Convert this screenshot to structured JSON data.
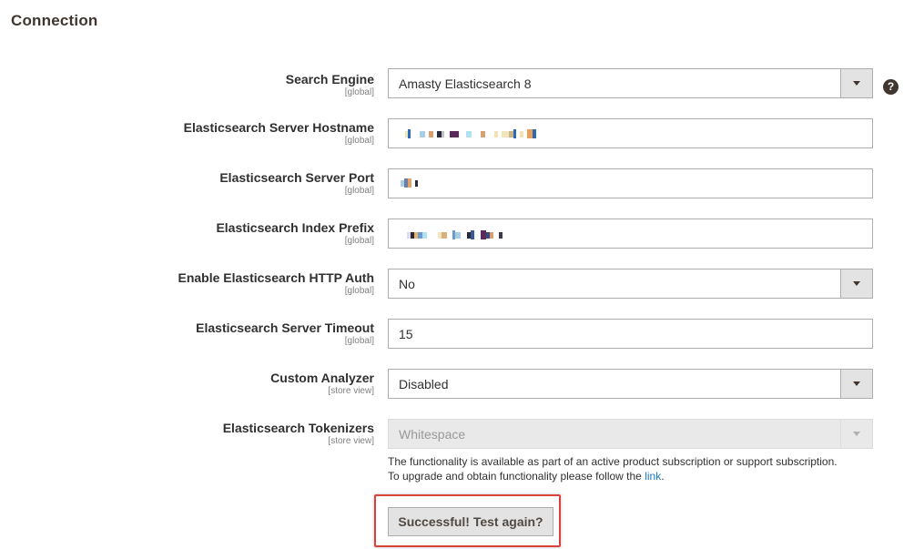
{
  "section": {
    "title": "Connection"
  },
  "fields": [
    {
      "label": "Search Engine",
      "scope": "[global]",
      "type": "select",
      "value": "Amasty Elasticsearch 8"
    },
    {
      "label": "Elasticsearch Server Hostname",
      "scope": "[global]",
      "type": "text",
      "value": ""
    },
    {
      "label": "Elasticsearch Server Port",
      "scope": "[global]",
      "type": "text",
      "value": ""
    },
    {
      "label": "Elasticsearch Index Prefix",
      "scope": "[global]",
      "type": "text",
      "value": ""
    },
    {
      "label": "Enable Elasticsearch HTTP Auth",
      "scope": "[global]",
      "type": "select",
      "value": "No"
    },
    {
      "label": "Elasticsearch Server Timeout",
      "scope": "[global]",
      "type": "text",
      "value": "15"
    },
    {
      "label": "Custom Analyzer",
      "scope": "[store view]",
      "type": "select",
      "value": "Disabled"
    },
    {
      "label": "Elasticsearch Tokenizers",
      "scope": "[store view]",
      "type": "select",
      "value": "Whitespace",
      "disabled": true
    }
  ],
  "note": {
    "line1": "The functionality is available as part of an active product subscription or support subscription.",
    "line2_prefix": "To upgrade and obtain functionality please follow the ",
    "link_text": "link",
    "line2_suffix": "."
  },
  "test_button": {
    "label": "Successful! Test again?"
  },
  "help_icon": {
    "glyph": "?",
    "icon": "question-circle-icon"
  },
  "colors": {
    "link": "#1979c3",
    "highlight": "#d9413e",
    "heading": "#41362f"
  }
}
